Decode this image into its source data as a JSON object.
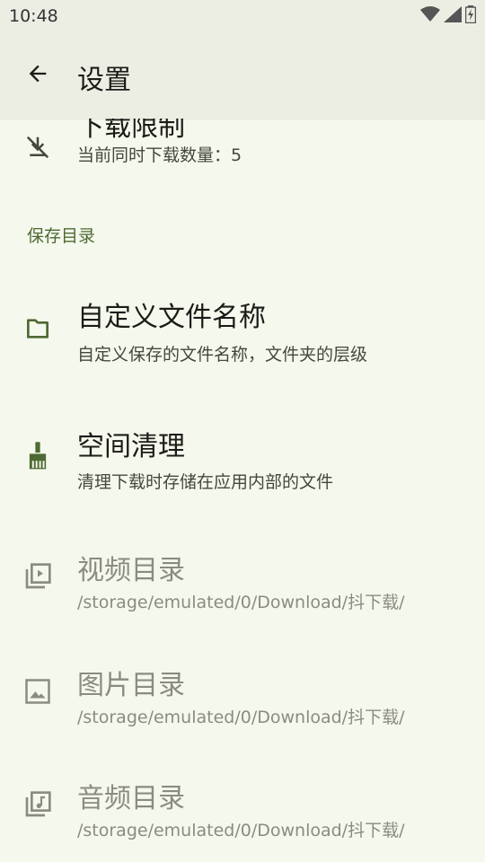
{
  "status_bar": {
    "time": "10:48",
    "icons": [
      "wifi-icon",
      "signal-icon",
      "battery-charging-icon"
    ]
  },
  "app_bar": {
    "title": "设置",
    "back_icon": "arrow-back-icon"
  },
  "settings": {
    "download_limit": {
      "title": "下载限制",
      "subtitle": "当前同时下载数量：5",
      "icon": "download-off-icon"
    },
    "section_save_dir": "保存目录",
    "custom_filename": {
      "title": "自定义文件名称",
      "subtitle": "自定义保存的文件名称，文件夹的层级",
      "icon": "folder-icon"
    },
    "space_cleanup": {
      "title": "空间清理",
      "subtitle": "清理下载时存储在应用内部的文件",
      "icon": "broom-icon"
    },
    "video_dir": {
      "title": "视频目录",
      "subtitle": "/storage/emulated/0/Download/抖下载/",
      "icon": "video-library-icon"
    },
    "image_dir": {
      "title": "图片目录",
      "subtitle": "/storage/emulated/0/Download/抖下载/",
      "icon": "image-icon"
    },
    "audio_dir": {
      "title": "音频目录",
      "subtitle": "/storage/emulated/0/Download/抖下载/",
      "icon": "music-library-icon"
    }
  },
  "colors": {
    "background": "#f5f8ec",
    "app_bar": "#eceee4",
    "accent": "#4d6a34",
    "text_primary": "#1b1c18",
    "text_disabled": "#8a8c84"
  }
}
